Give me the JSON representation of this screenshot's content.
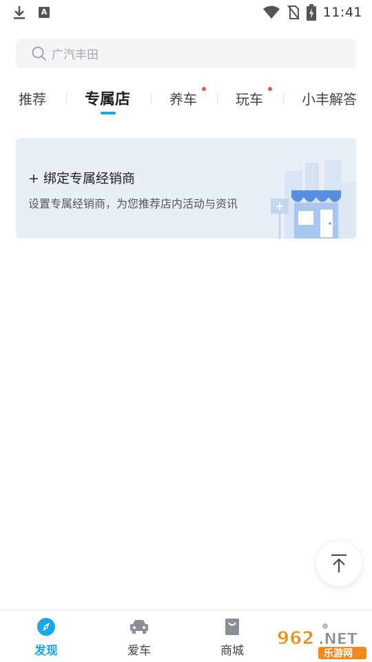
{
  "status_bar": {
    "time": "11:41",
    "left_icons": [
      "download-icon",
      "keyboard-a-icon"
    ],
    "right_icons": [
      "wifi-icon",
      "no-sim-icon",
      "battery-charging-icon"
    ]
  },
  "search": {
    "placeholder": "广汽丰田"
  },
  "tabs": [
    {
      "label": "推荐",
      "active": false,
      "has_dot": false
    },
    {
      "label": "专属店",
      "active": true,
      "has_dot": false
    },
    {
      "label": "养车",
      "active": false,
      "has_dot": true
    },
    {
      "label": "玩车",
      "active": false,
      "has_dot": true
    },
    {
      "label": "小丰解答",
      "active": false,
      "has_dot": false
    }
  ],
  "dealer_card": {
    "title": "+ 绑定专属经销商",
    "subtitle": "设置专属经销商，为您推荐店内活动与资讯",
    "illustration": "storefront-illustration"
  },
  "back_to_top": {
    "icon": "arrow-up-icon"
  },
  "bottom_nav": [
    {
      "label": "发现",
      "icon": "compass-icon",
      "active": true
    },
    {
      "label": "爱车",
      "icon": "car-icon",
      "active": false
    },
    {
      "label": "商城",
      "icon": "shopping-bag-icon",
      "active": false
    }
  ],
  "watermark": {
    "text_top": "962.NET",
    "text_bottom": "乐游网"
  },
  "colors": {
    "accent": "#1aa7e6",
    "dot": "#ea5a3c",
    "card_bg": "#e8eff8",
    "search_bg": "#f4f5f7"
  }
}
